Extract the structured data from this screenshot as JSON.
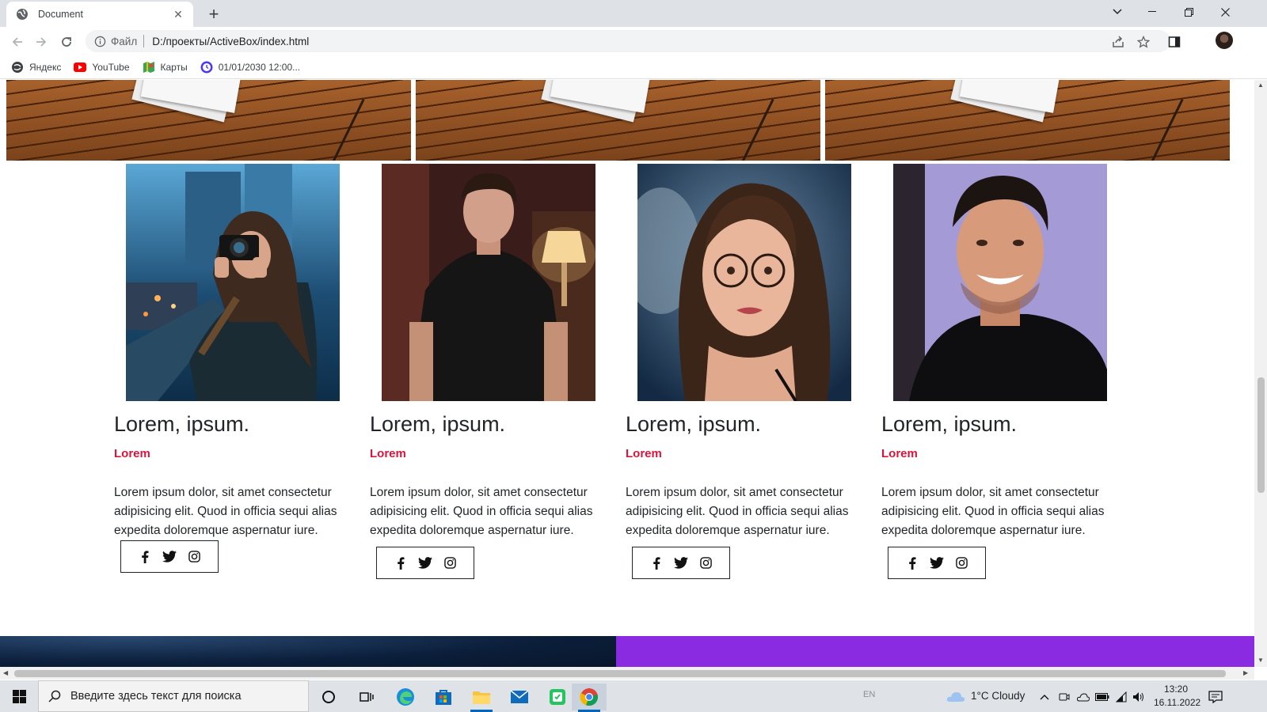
{
  "browser": {
    "tab_title": "Document",
    "new_tab_symbol": "+",
    "address_scheme": "Файл",
    "address_url": "D:/проекты/ActiveBox/index.html",
    "bookmarks": [
      {
        "label": "Яндекс",
        "icon": "yandex-icon"
      },
      {
        "label": "YouTube",
        "icon": "youtube-icon"
      },
      {
        "label": "Карты",
        "icon": "maps-icon"
      },
      {
        "label": "01/01/2030 12:00...",
        "icon": "clock-icon"
      }
    ]
  },
  "team": {
    "cards": [
      {
        "name": "Lorem, ipsum.",
        "role": "Lorem",
        "text": "Lorem ipsum dolor, sit amet consectetur adipisicing elit. Quod in officia sequi alias expedita doloremque aspernatur iure.",
        "photo": "woman-with-camera-photo"
      },
      {
        "name": "Lorem, ipsum.",
        "role": "Lorem",
        "text": "Lorem ipsum dolor, sit amet consectetur adipisicing elit. Quod in officia sequi alias expedita doloremque aspernatur iure.",
        "photo": "young-man-black-tshirt-photo"
      },
      {
        "name": "Lorem, ipsum.",
        "role": "Lorem",
        "text": "Lorem ipsum dolor, sit amet consectetur adipisicing elit. Quod in officia sequi alias expedita doloremque aspernatur iure.",
        "photo": "woman-with-glasses-illustration"
      },
      {
        "name": "Lorem, ipsum.",
        "role": "Lorem",
        "text": "Lorem ipsum dolor, sit amet consectetur adipisicing elit. Quod in officia sequi alias expedita doloremque aspernatur iure.",
        "photo": "smiling-man-photo"
      }
    ],
    "social_icons": [
      "facebook-icon",
      "twitter-icon",
      "instagram-icon"
    ]
  },
  "colors": {
    "accent_red": "#dc143c",
    "purple_block": "#8a2be2"
  },
  "taskbar": {
    "search_placeholder": "Введите здесь текст для поиска",
    "language": "EN",
    "weather": "1°C  Cloudy",
    "time": "13:20",
    "date": "16.11.2022"
  }
}
